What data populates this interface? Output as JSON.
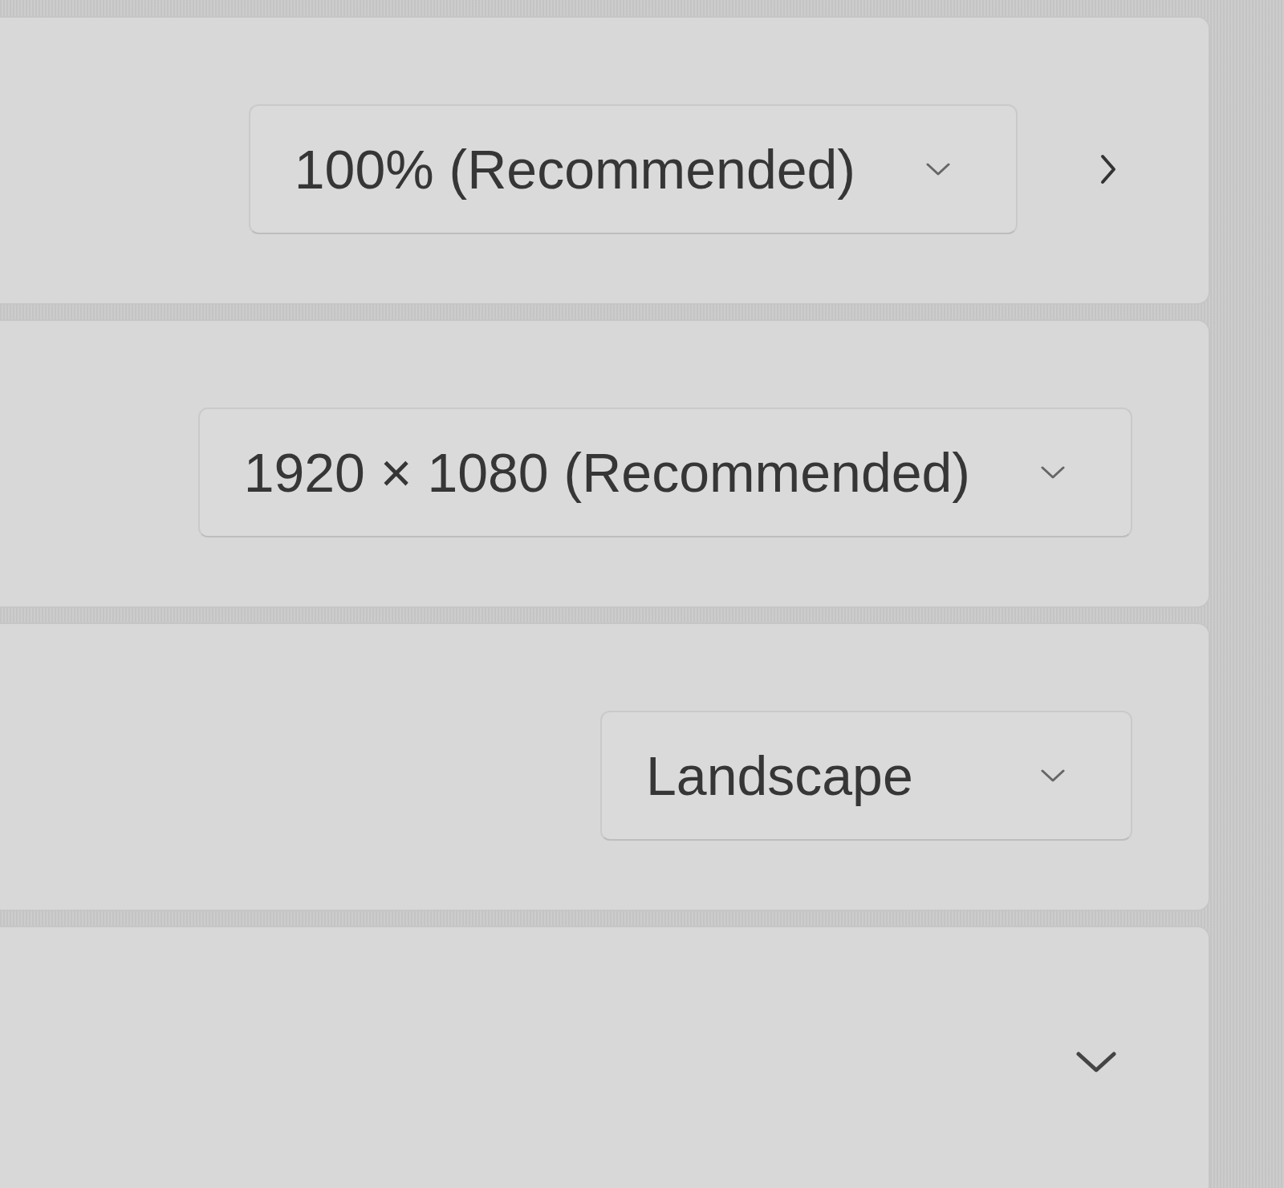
{
  "settings_rows": [
    {
      "kind": "dropdown_link",
      "value": "100% (Recommended)"
    },
    {
      "kind": "dropdown",
      "value": "1920 × 1080 (Recommended)"
    },
    {
      "kind": "dropdown",
      "value": "Landscape"
    },
    {
      "kind": "expander",
      "expanded": false
    }
  ]
}
